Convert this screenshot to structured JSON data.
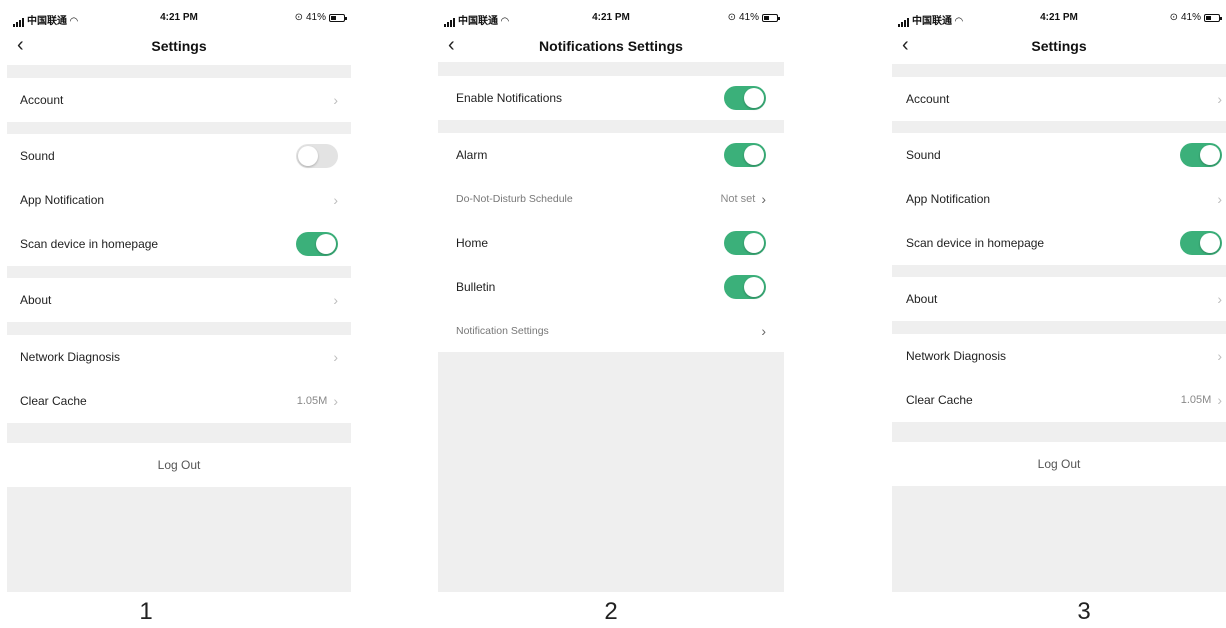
{
  "status": {
    "carrier": "中国联通",
    "time": "4:21 PM",
    "battery": "41%"
  },
  "screen1": {
    "title": "Settings",
    "account": "Account",
    "sound": "Sound",
    "app_notification": "App Notification",
    "scan_device": "Scan device in homepage",
    "about": "About",
    "network_diagnosis": "Network Diagnosis",
    "clear_cache": "Clear Cache",
    "cache_size": "1.05M",
    "logout": "Log Out",
    "caption": "1"
  },
  "screen2": {
    "title": "Notifications Settings",
    "enable_notifications": "Enable Notifications",
    "alarm": "Alarm",
    "dnd_schedule": "Do-Not-Disturb Schedule",
    "dnd_value": "Not set",
    "home": "Home",
    "bulletin": "Bulletin",
    "notification_settings": "Notification Settings",
    "caption": "2"
  },
  "screen3": {
    "title": "Settings",
    "account": "Account",
    "sound": "Sound",
    "app_notification": "App Notification",
    "scan_device": "Scan device in homepage",
    "about": "About",
    "network_diagnosis": "Network Diagnosis",
    "clear_cache": "Clear Cache",
    "cache_size": "1.05M",
    "logout": "Log Out",
    "caption": "3"
  },
  "toggles": {
    "s1_sound": "off",
    "s1_scan": "on",
    "s2_enable": "on",
    "s2_alarm": "on",
    "s2_home": "on",
    "s2_bulletin": "on",
    "s3_sound": "on",
    "s3_scan": "on"
  },
  "colors": {
    "accent": "#3bb07a",
    "toggle_off": "#e3e3e3",
    "separator": "#efefef"
  },
  "icons": [
    "back-icon",
    "chevron-right-icon",
    "signal-icon",
    "wifi-icon",
    "location-icon",
    "battery-icon"
  ]
}
